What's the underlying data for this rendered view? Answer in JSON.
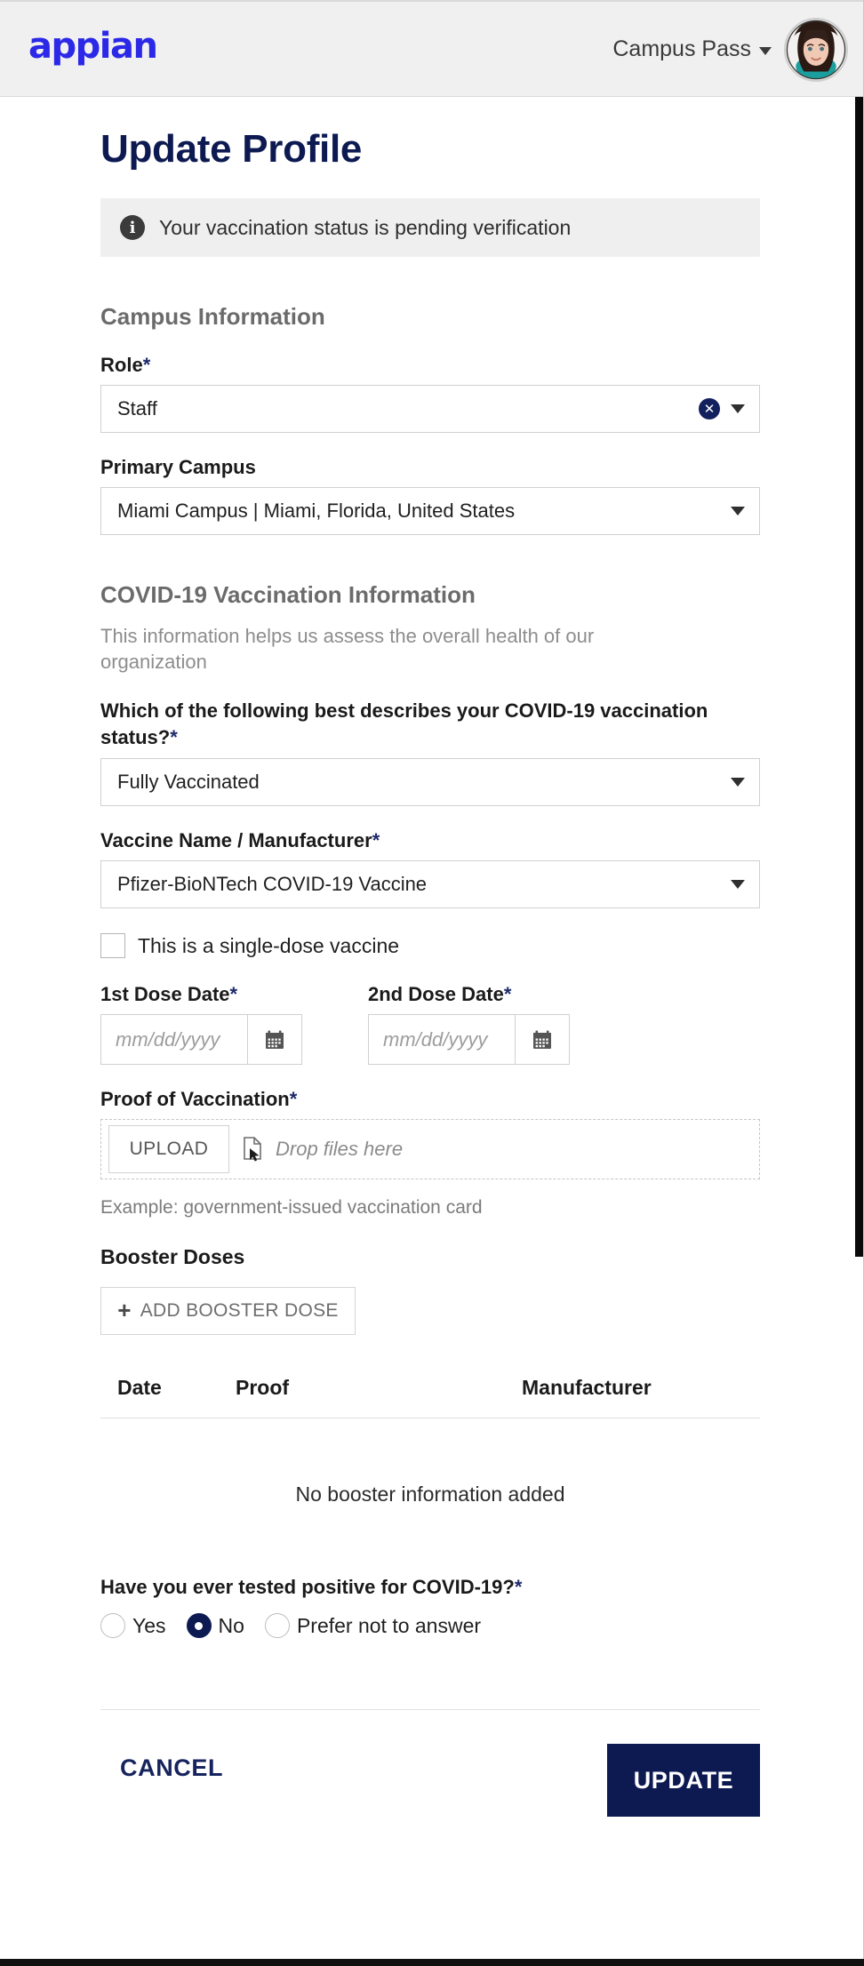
{
  "header": {
    "logo_text": "appian",
    "app_menu_label": "Campus Pass",
    "caret_icon": "chevron-down-icon",
    "avatar_alt": "user-avatar"
  },
  "page": {
    "title": "Update Profile"
  },
  "banner": {
    "icon": "info-icon",
    "icon_glyph": "i",
    "message": "Your vaccination status is pending verification",
    "background": "#efefef"
  },
  "campus_section": {
    "heading": "Campus Information",
    "role": {
      "label": "Role",
      "required_marker": "*",
      "value": "Staff",
      "clear_icon": "clear-x-icon",
      "clear_glyph": "✕",
      "chevron_icon": "chevron-down-icon"
    },
    "primary_campus": {
      "label": "Primary Campus",
      "value": "Miami Campus | Miami, Florida, United States",
      "chevron_icon": "chevron-down-icon"
    }
  },
  "covid_section": {
    "heading": "COVID-19 Vaccination Information",
    "subtext": "This information helps us assess the overall health of our organization",
    "status": {
      "label": "Which of the following best describes your COVID-19 vaccination status?",
      "required_marker": "*",
      "value": "Fully Vaccinated"
    },
    "vaccine": {
      "label": "Vaccine Name / Manufacturer",
      "required_marker": "*",
      "value": "Pfizer-BioNTech COVID-19 Vaccine"
    },
    "single_dose": {
      "label": "This is a single-dose vaccine",
      "checked": false
    },
    "dose1": {
      "label": "1st Dose Date",
      "required_marker": "*",
      "value": "",
      "placeholder": "mm/dd/yyyy",
      "calendar_icon": "calendar-icon"
    },
    "dose2": {
      "label": "2nd Dose Date",
      "required_marker": "*",
      "value": "",
      "placeholder": "mm/dd/yyyy",
      "calendar_icon": "calendar-icon"
    },
    "proof": {
      "label": "Proof of Vaccination",
      "required_marker": "*",
      "upload_button": "UPLOAD",
      "drop_text": "Drop files here",
      "file_icon": "file-upload-icon",
      "example_note": "Example: government-issued vaccination card"
    },
    "booster": {
      "label": "Booster Doses",
      "add_button": "ADD BOOSTER DOSE",
      "add_icon": "plus-icon",
      "add_glyph": "+",
      "table": {
        "columns": [
          "Date",
          "Proof",
          "Manufacturer"
        ],
        "rows": [],
        "empty_message": "No booster information added"
      }
    },
    "tested_positive": {
      "label": "Have you ever tested positive for COVID-19?",
      "required_marker": "*",
      "options": [
        {
          "label": "Yes",
          "selected": false
        },
        {
          "label": "No",
          "selected": true
        },
        {
          "label": "Prefer not to answer",
          "selected": false
        }
      ]
    }
  },
  "footer": {
    "cancel_label": "CANCEL",
    "update_label": "UPDATE",
    "update_color": "#0d1a52"
  }
}
